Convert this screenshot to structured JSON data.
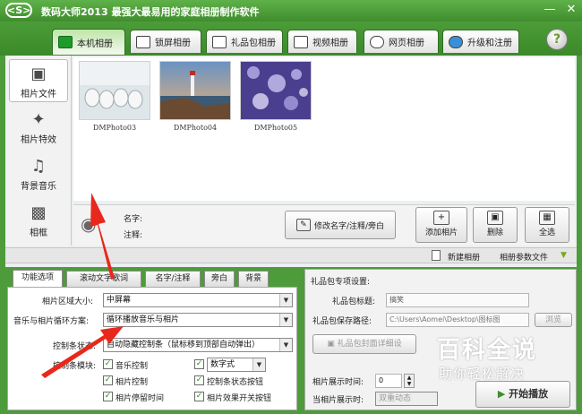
{
  "titlebar": {
    "logo_text": "<S>",
    "title": "数码大师2013    最强大最易用的家庭相册制作软件",
    "minimize": "—",
    "close": "✕"
  },
  "main_tabs": [
    {
      "label": "本机相册",
      "active": true,
      "icon": "photo-album-icon"
    },
    {
      "label": "锁屏相册",
      "icon": "monitor-icon"
    },
    {
      "label": "礼品包相册",
      "icon": "gift-icon"
    },
    {
      "label": "视频相册",
      "icon": "film-icon"
    },
    {
      "label": "网页相册",
      "icon": "ie-icon"
    },
    {
      "label": "升级和注册",
      "icon": "globe-icon"
    }
  ],
  "help_label": "?",
  "sidebar": [
    {
      "label": "相片文件",
      "active": true,
      "icon": "camera-icon"
    },
    {
      "label": "相片特效",
      "icon": "effects-icon"
    },
    {
      "label": "背景音乐",
      "icon": "music-note-icon"
    },
    {
      "label": "相框",
      "icon": "frame-icon"
    }
  ],
  "photos": [
    {
      "name": "DMPhoto03"
    },
    {
      "name": "DMPhoto04"
    },
    {
      "name": "DMPhoto05"
    }
  ],
  "info": {
    "name_label": "名字:",
    "note_label": "注释:",
    "rename_button": "修改名字/注释/旁白",
    "add_button": "添加相片",
    "delete_button": "删除",
    "select_all_button": "全选"
  },
  "strip": {
    "new_album": "新建相册",
    "album_params": "相册参数文件"
  },
  "sub_tabs": [
    "功能选项",
    "滚动文字歌词",
    "名字/注释",
    "旁白",
    "背景"
  ],
  "options": {
    "area_label": "相片区域大小:",
    "area_value": "中屏幕",
    "loop_label": "音乐与相片循环方案:",
    "loop_value": "循环播放音乐与相片",
    "control_label": "控制条状态:",
    "control_value": "自动隐藏控制条（鼠标移到顶部自动弹出）",
    "module_label": "控制条模块:",
    "checks": [
      {
        "label": "音乐控制"
      },
      {
        "label": "相片控制"
      },
      {
        "label": "相片停留时间"
      },
      {
        "label": "控制条状态按钮"
      },
      {
        "label": "相片效果开关按钮"
      }
    ],
    "digital_value": "数字式"
  },
  "gift": {
    "section_title": "礼品包专项设置:",
    "title_label": "礼品包标题:",
    "title_value": "搞笑",
    "path_label": "礼品包保存路径:",
    "path_value": "C:\\Users\\Aomei\\Desktop\\图标图",
    "browse_label": "浏览",
    "cover_button": "礼品包封面详细设"
  },
  "playback": {
    "show_time_label": "相片展示时间:",
    "show_time_value": "0",
    "when_label": "当相片展示时:",
    "when_value": "双重动态",
    "start_button": "开始播放"
  },
  "watermark": {
    "line1": "百科全说",
    "line2": "助你轻松解决"
  },
  "colors": {
    "accent_green": "#4d9b3a",
    "arrow_red": "#e8281c"
  }
}
